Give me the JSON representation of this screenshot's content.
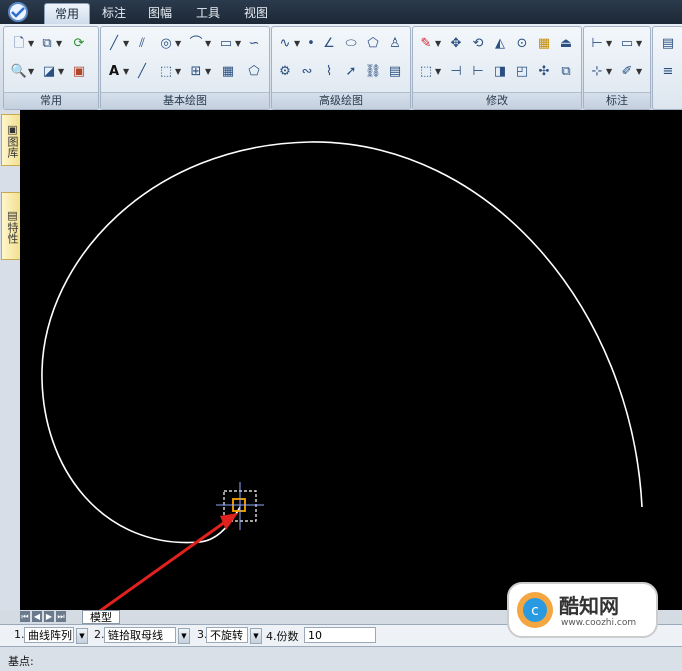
{
  "ribbon_tabs": [
    "常用",
    "标注",
    "图幅",
    "工具",
    "视图"
  ],
  "groups": {
    "common": "常用",
    "basic_draw": "基本绘图",
    "advanced_draw": "高级绘图",
    "modify": "修改",
    "annotation": "标注"
  },
  "dock_tabs": [
    "图库",
    "特性"
  ],
  "model_tab": "模型",
  "command_bar": {
    "opt1_prefix": "1.",
    "opt1_value": "曲线阵列",
    "opt2_prefix": "2.",
    "opt2_value": "链拾取母线",
    "opt3_prefix": "3.",
    "opt3_value": "不旋转",
    "opt4_label": "4.份数",
    "count_value": "10"
  },
  "status": {
    "prompt": "基点:"
  },
  "watermark": {
    "brand": "酷知网",
    "url": "www.coozhi.com"
  }
}
